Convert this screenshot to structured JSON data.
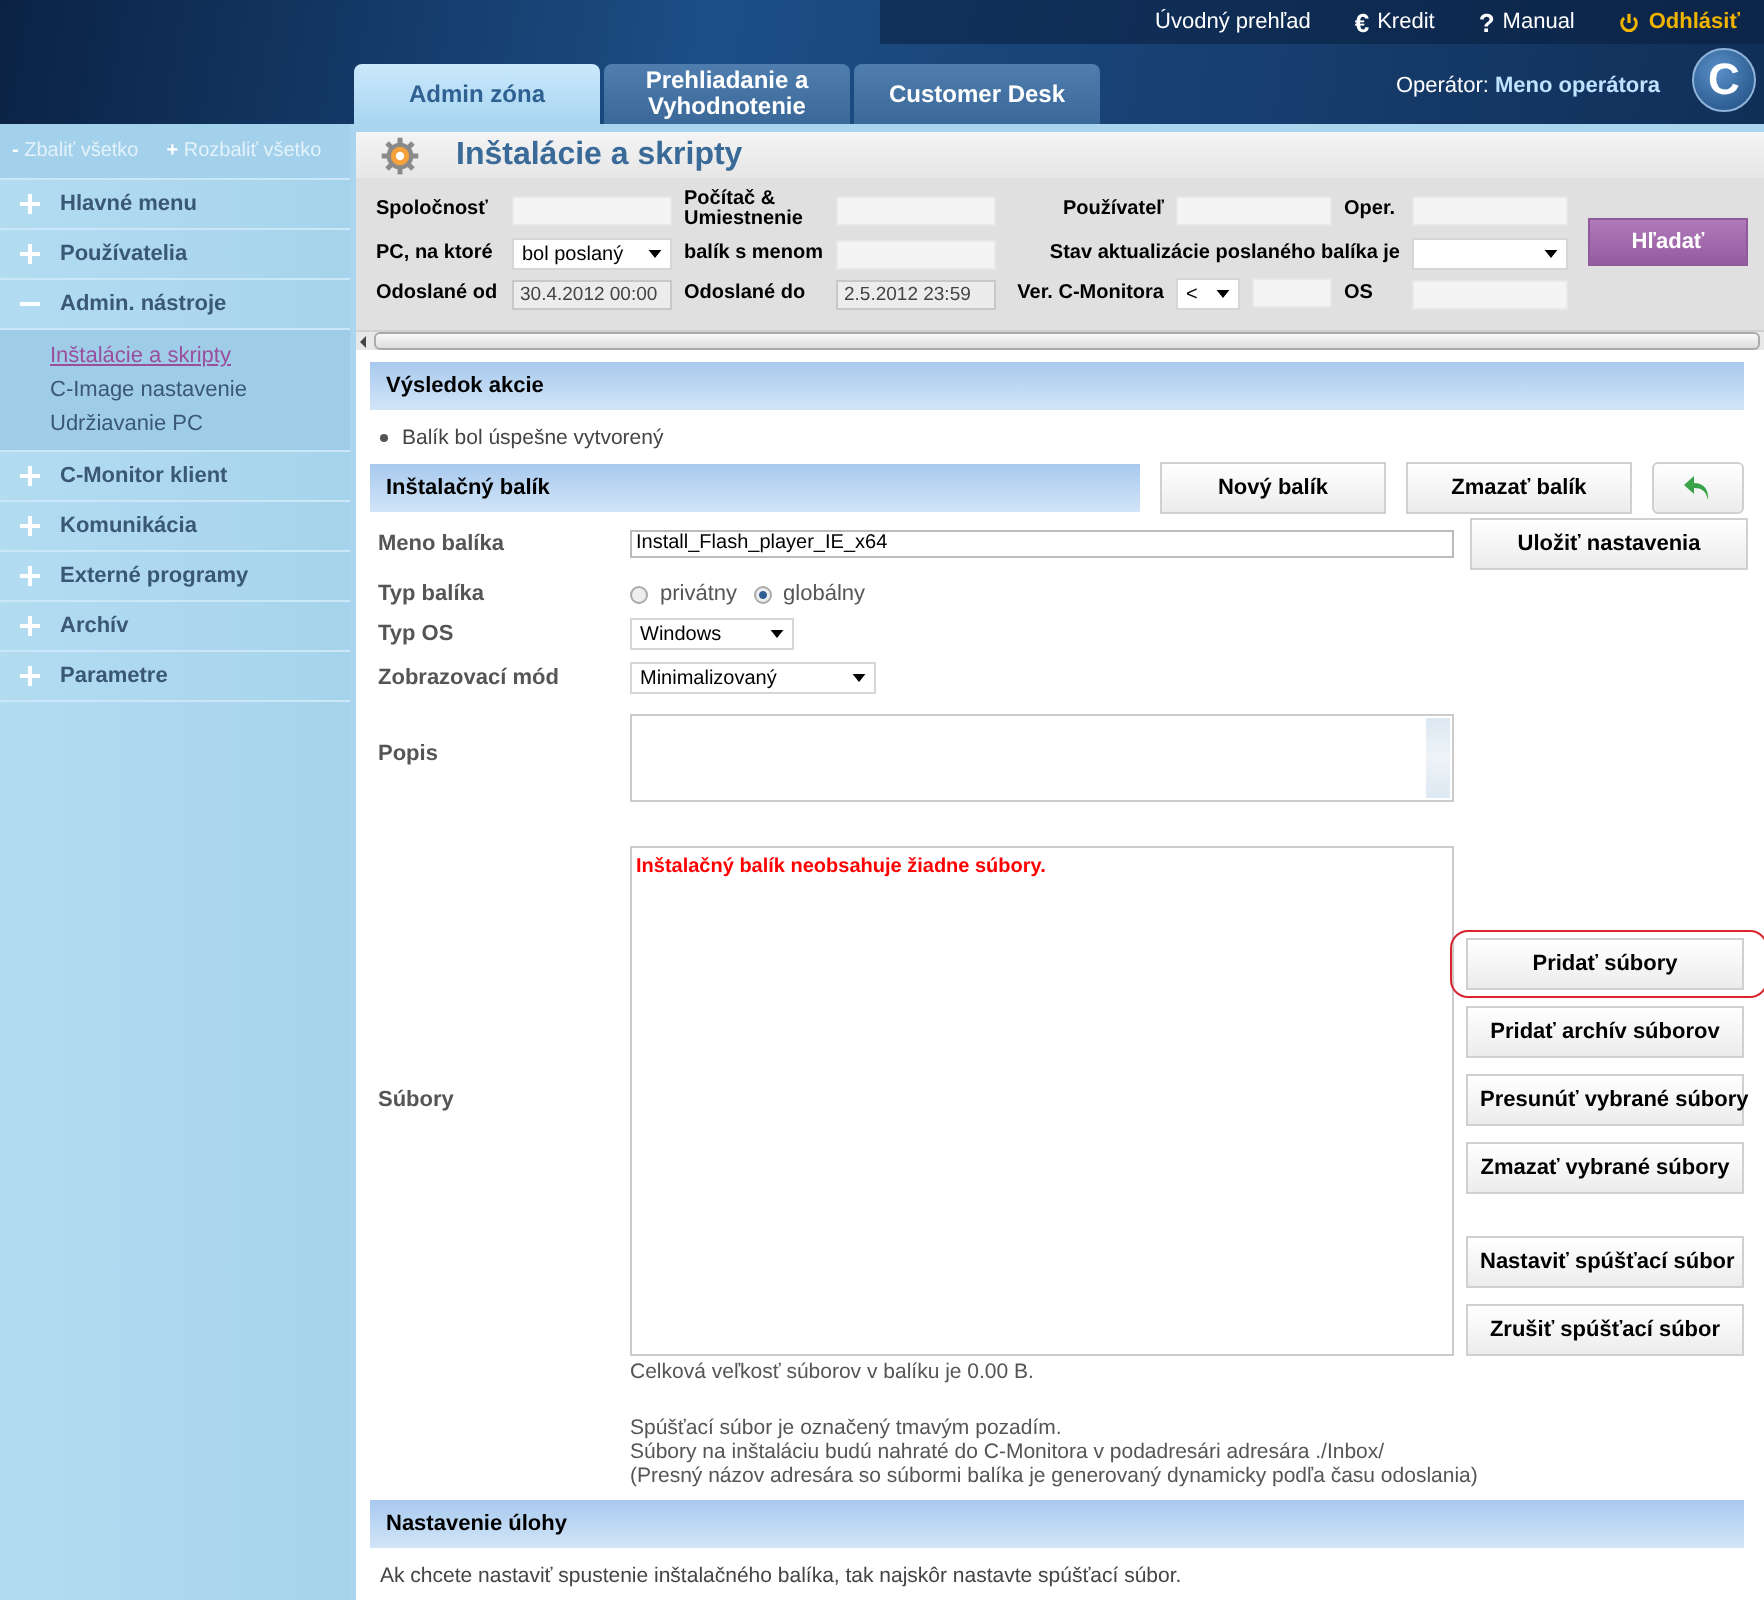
{
  "header": {
    "top_links": [
      {
        "kind": "link",
        "label": "Úvodný prehľad"
      },
      {
        "kind": "link",
        "icon": "€",
        "label": "Kredit"
      },
      {
        "kind": "link",
        "icon": "?",
        "label": "Manual"
      },
      {
        "kind": "logout",
        "label": "Odhlásiť"
      }
    ],
    "tabs": [
      {
        "label": "Admin zóna",
        "selected": true
      },
      {
        "label": "Prehliadanie a Vyhodnotenie",
        "selected": false
      },
      {
        "label": "Customer Desk",
        "selected": false
      }
    ],
    "operator_label": "Operátor:",
    "operator_name": "Meno operátora",
    "logo": "C"
  },
  "sidebar": {
    "collapse_icon": "-",
    "collapse_all": "Zbaliť všetko",
    "expand_icon": "+",
    "expand_all": "Rozbaliť všetko",
    "items": [
      {
        "label": "Hlavné menu",
        "expanded": false
      },
      {
        "label": "Používatelia",
        "expanded": false
      },
      {
        "label": "Admin. nástroje",
        "expanded": true,
        "children": [
          {
            "label": "Inštalácie a skripty",
            "selected": true
          },
          {
            "label": "C-Image nastavenie",
            "selected": false
          },
          {
            "label": "Udržiavanie PC",
            "selected": false
          }
        ]
      },
      {
        "label": "C-Monitor klient",
        "expanded": false
      },
      {
        "label": "Komunikácia",
        "expanded": false
      },
      {
        "label": "Externé programy",
        "expanded": false
      },
      {
        "label": "Archív",
        "expanded": false
      },
      {
        "label": "Parametre",
        "expanded": false
      }
    ]
  },
  "page_title": "Inštalácie a skripty",
  "filters": {
    "rows": [
      [
        {
          "label": "Spoločnosť",
          "kind": "input"
        },
        {
          "label": "Počítač & Umiestnenie",
          "kind": "input"
        },
        {
          "label": "Používateľ",
          "kind": "input"
        },
        {
          "label": "Oper.",
          "kind": "input"
        }
      ],
      [
        {
          "label": "PC, na ktoré",
          "kind": "select",
          "value": "bol poslaný"
        },
        {
          "label": "balík s menom",
          "kind": "input"
        },
        {
          "label": "Stav aktualizácie poslaného balíka je",
          "kind": "select"
        }
      ],
      [
        {
          "label": "Odoslané od",
          "kind": "readonly",
          "value": "30.4.2012 00:00"
        },
        {
          "label": "Odoslané do",
          "kind": "readonly",
          "value": "2.5.2012 23:59"
        },
        {
          "label": "Ver. C-Monitora",
          "kind": "version",
          "value": "<"
        },
        {
          "label": "OS",
          "kind": "input"
        }
      ]
    ],
    "search_button": "Hľadať"
  },
  "result": {
    "title": "Výsledok akcie",
    "messages": [
      "Balík bol úspešne vytvorený"
    ]
  },
  "package": {
    "title": "Inštalačný balík",
    "buttons": [
      "Nový balík",
      "Zmazať balík"
    ],
    "name_label": "Meno balíka",
    "name_value": "Install_Flash_player_IE_x64",
    "save_button": "Uložiť nastavenia",
    "type_label": "Typ balíka",
    "type_options": [
      {
        "label": "privátny",
        "selected": false
      },
      {
        "label": "globálny",
        "selected": true
      }
    ],
    "os_label": "Typ OS",
    "os_value": "Windows",
    "mode_label": "Zobrazovací mód",
    "mode_value": "Minimalizovaný",
    "description_label": "Popis",
    "files_label": "Súbory",
    "files_message": "Inštalačný balík neobsahuje žiadne súbory.",
    "total_size": "Celková veľkosť súborov v balíku je 0.00 B.",
    "file_button_groups": [
      [
        {
          "label": "Pridať súbory",
          "highlighted": true
        },
        {
          "label": "Pridať archív súborov",
          "highlighted": false
        },
        {
          "label": "Presunúť vybrané súbory",
          "highlighted": false
        },
        {
          "label": "Zmazať vybrané súbory",
          "highlighted": false
        }
      ],
      [
        {
          "label": "Nastaviť spúšťací súbor",
          "highlighted": false
        },
        {
          "label": "Zrušiť spúšťací súbor",
          "highlighted": false
        }
      ]
    ],
    "notes": [
      "Spúšťací súbor je označený tmavým pozadím.",
      "Súbory na inštaláciu budú nahraté do C-Monitora v podadresári adresára ./Inbox/",
      "(Presný názov adresára so súbormi balíka je generovaný dynamicky podľa času odoslania)"
    ]
  },
  "task": {
    "title": "Nastavenie úlohy",
    "text": "Ak chcete nastaviť spustenie inštalačného balíka, tak najskôr nastavte spúšťací súbor."
  }
}
